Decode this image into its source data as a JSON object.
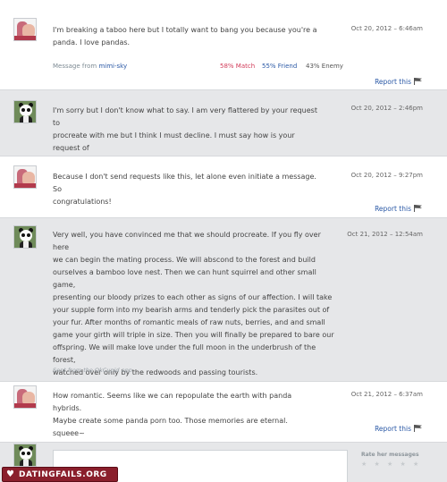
{
  "messages": [
    {
      "sender": "mimi-sky",
      "body": "I'm breaking a taboo here but I totally want to bang you because you're a\npanda.  I love pandas.",
      "date": "Oct 20, 2012 – 6:46am",
      "from_label": "Message from",
      "username": "mimi-sky",
      "match": "58% Match",
      "friend": "55% Friend",
      "enemy": "43% Enemy",
      "report": "Report this"
    },
    {
      "sender": "panda",
      "body": "I'm sorry but I don't know what to say.  I am very flattered by your request to\nprocreate with me but I think I must decline.  I must say how is your request of\nprocreation breaking a taboo?",
      "date": "Oct 20, 2012 – 2:46pm"
    },
    {
      "sender": "mimi-sky",
      "body": "Because I don't send requests like this, let alone even initiate a message.  So\ncongratulations!",
      "date": "Oct 20, 2012 – 9:27pm",
      "report": "Report this"
    },
    {
      "sender": "panda",
      "body": "Very well, you have convinced me that we should procreate.  If you fly over here\nwe can begin the mating process.  We will abscond to the forest and build\nourselves a bamboo love nest.  Then we can hunt squirrel and other small game,\npresenting our bloody prizes to each other as signs of our affection.  I will take\nyour supple form into my bearish arms and tenderly pick the parasites out of\nyour fur.  After months of romantic meals of raw nuts, berries, and and small\ngame your girth will triple in size.  Then you will finally be prepared to bare our\noffspring.  We will make love under the full moon in the underbrush of the forest,\nwatched over only by the redwoods and passing tourists.\n\nFrom there it will be a long downward spiral of alcohol until we both part ways.\nWe will always have the memories of our good times though.",
      "date": "Oct 21, 2012 – 12:54am",
      "via": "Sent from the OkCupid app"
    },
    {
      "sender": "mimi-sky",
      "body": "How romantic.  Seems like we can repopulate the earth with panda hybrids.\nMaybe create some panda porn too.  Those memories are eternal.  squeee~",
      "date": "Oct 21, 2012 – 6:37am",
      "report": "Report this"
    }
  ],
  "sidebar": {
    "rate_label": "Rate her messages",
    "rate_stars": "★ ★ ★ ★ ★"
  },
  "watermark": {
    "text": "DATINGFAILS.ORG",
    "icon": "heart-icon"
  },
  "colors": {
    "match": "#d23c5a",
    "friend": "#2b59a6",
    "enemy": "#555555",
    "link": "#2b59a6"
  }
}
